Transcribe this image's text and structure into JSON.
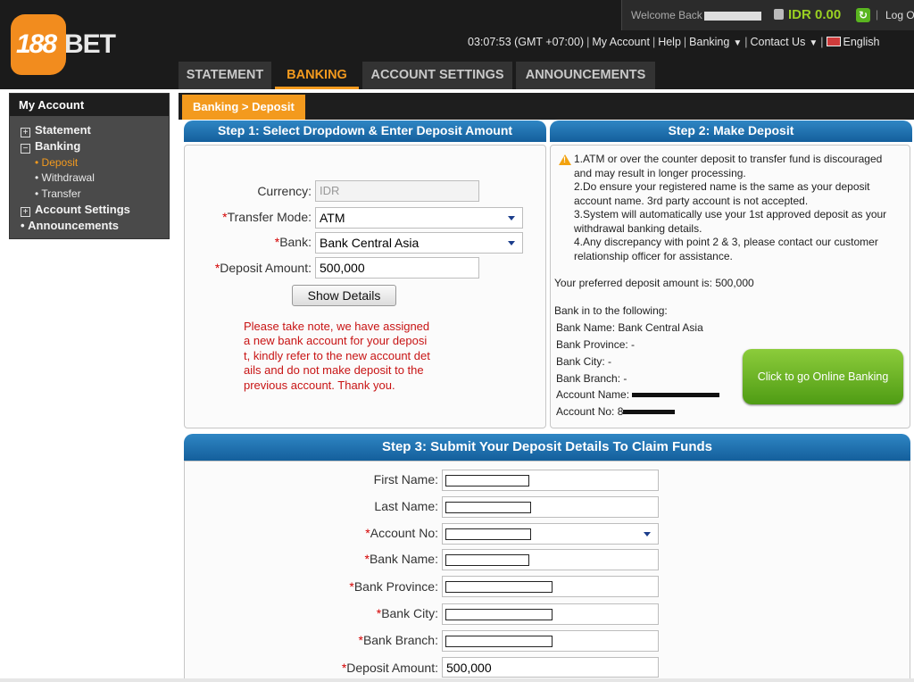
{
  "header": {
    "logo_number": "188",
    "logo_text": "BET",
    "welcome": "Welcome Back",
    "balance": "IDR 0.00",
    "logout": "Log O",
    "time": "03:07:53 (GMT +07:00)",
    "links": {
      "my_account": "My Account",
      "help": "Help",
      "banking": "Banking",
      "contact": "Contact Us",
      "language": "English"
    }
  },
  "tabs": [
    "STATEMENT",
    "BANKING",
    "ACCOUNT SETTINGS",
    "ANNOUNCEMENTS"
  ],
  "sidebar": {
    "title": "My Account",
    "items": {
      "statement": "Statement",
      "banking": "Banking",
      "deposit": "Deposit",
      "withdrawal": "Withdrawal",
      "transfer": "Transfer",
      "account_settings": "Account Settings",
      "announcements": "Announcements"
    }
  },
  "breadcrumb": "Banking > Deposit",
  "step1": {
    "title": "Step 1: Select Dropdown & Enter Deposit Amount",
    "currency_label": "Currency:",
    "currency_value": "IDR",
    "transfer_mode_label": "Transfer Mode:",
    "transfer_mode_value": "ATM",
    "bank_label": "Bank:",
    "bank_value": "Bank Central Asia",
    "amount_label": "Deposit Amount:",
    "amount_value": "500,000",
    "show_details": "Show Details",
    "notice": "Please take note, we have assigned a new bank account for your deposit, kindly refer to the new account details and do not make deposit to the previous account. Thank you."
  },
  "step2": {
    "title": "Step 2: Make Deposit",
    "notes": [
      "1.ATM or over the counter deposit to transfer fund is discouraged",
      "and may result in longer processing.",
      "2.Do ensure your registered name is the same as your deposit",
      "account name. 3rd party account is not accepted.",
      "3.System will automatically use your 1st approved deposit as your",
      "withdrawal banking details.",
      "4.Any discrepancy with point 2 & 3, please contact our customer",
      "relationship officer for assistance."
    ],
    "preferred_amount": "Your preferred deposit amount is: 500,000",
    "bank_in_heading": "Bank in to the following:",
    "bank_name": "Bank Name: Bank Central Asia",
    "bank_province": "Bank Province: -",
    "bank_city": "Bank City: -",
    "bank_branch": "Bank Branch: -",
    "account_name_label": "Account Name:",
    "account_no_label": "Account No: 8",
    "online_banking": "Click to go Online Banking"
  },
  "step3": {
    "title": "Step 3: Submit Your Deposit Details To Claim Funds",
    "first_name": "First Name:",
    "last_name": "Last Name:",
    "account_no": "Account No:",
    "bank_name": "Bank Name:",
    "bank_province": "Bank Province:",
    "bank_city": "Bank City:",
    "bank_branch": "Bank Branch:",
    "deposit_amount": "Deposit Amount:",
    "deposit_amount_value": "500,000"
  }
}
